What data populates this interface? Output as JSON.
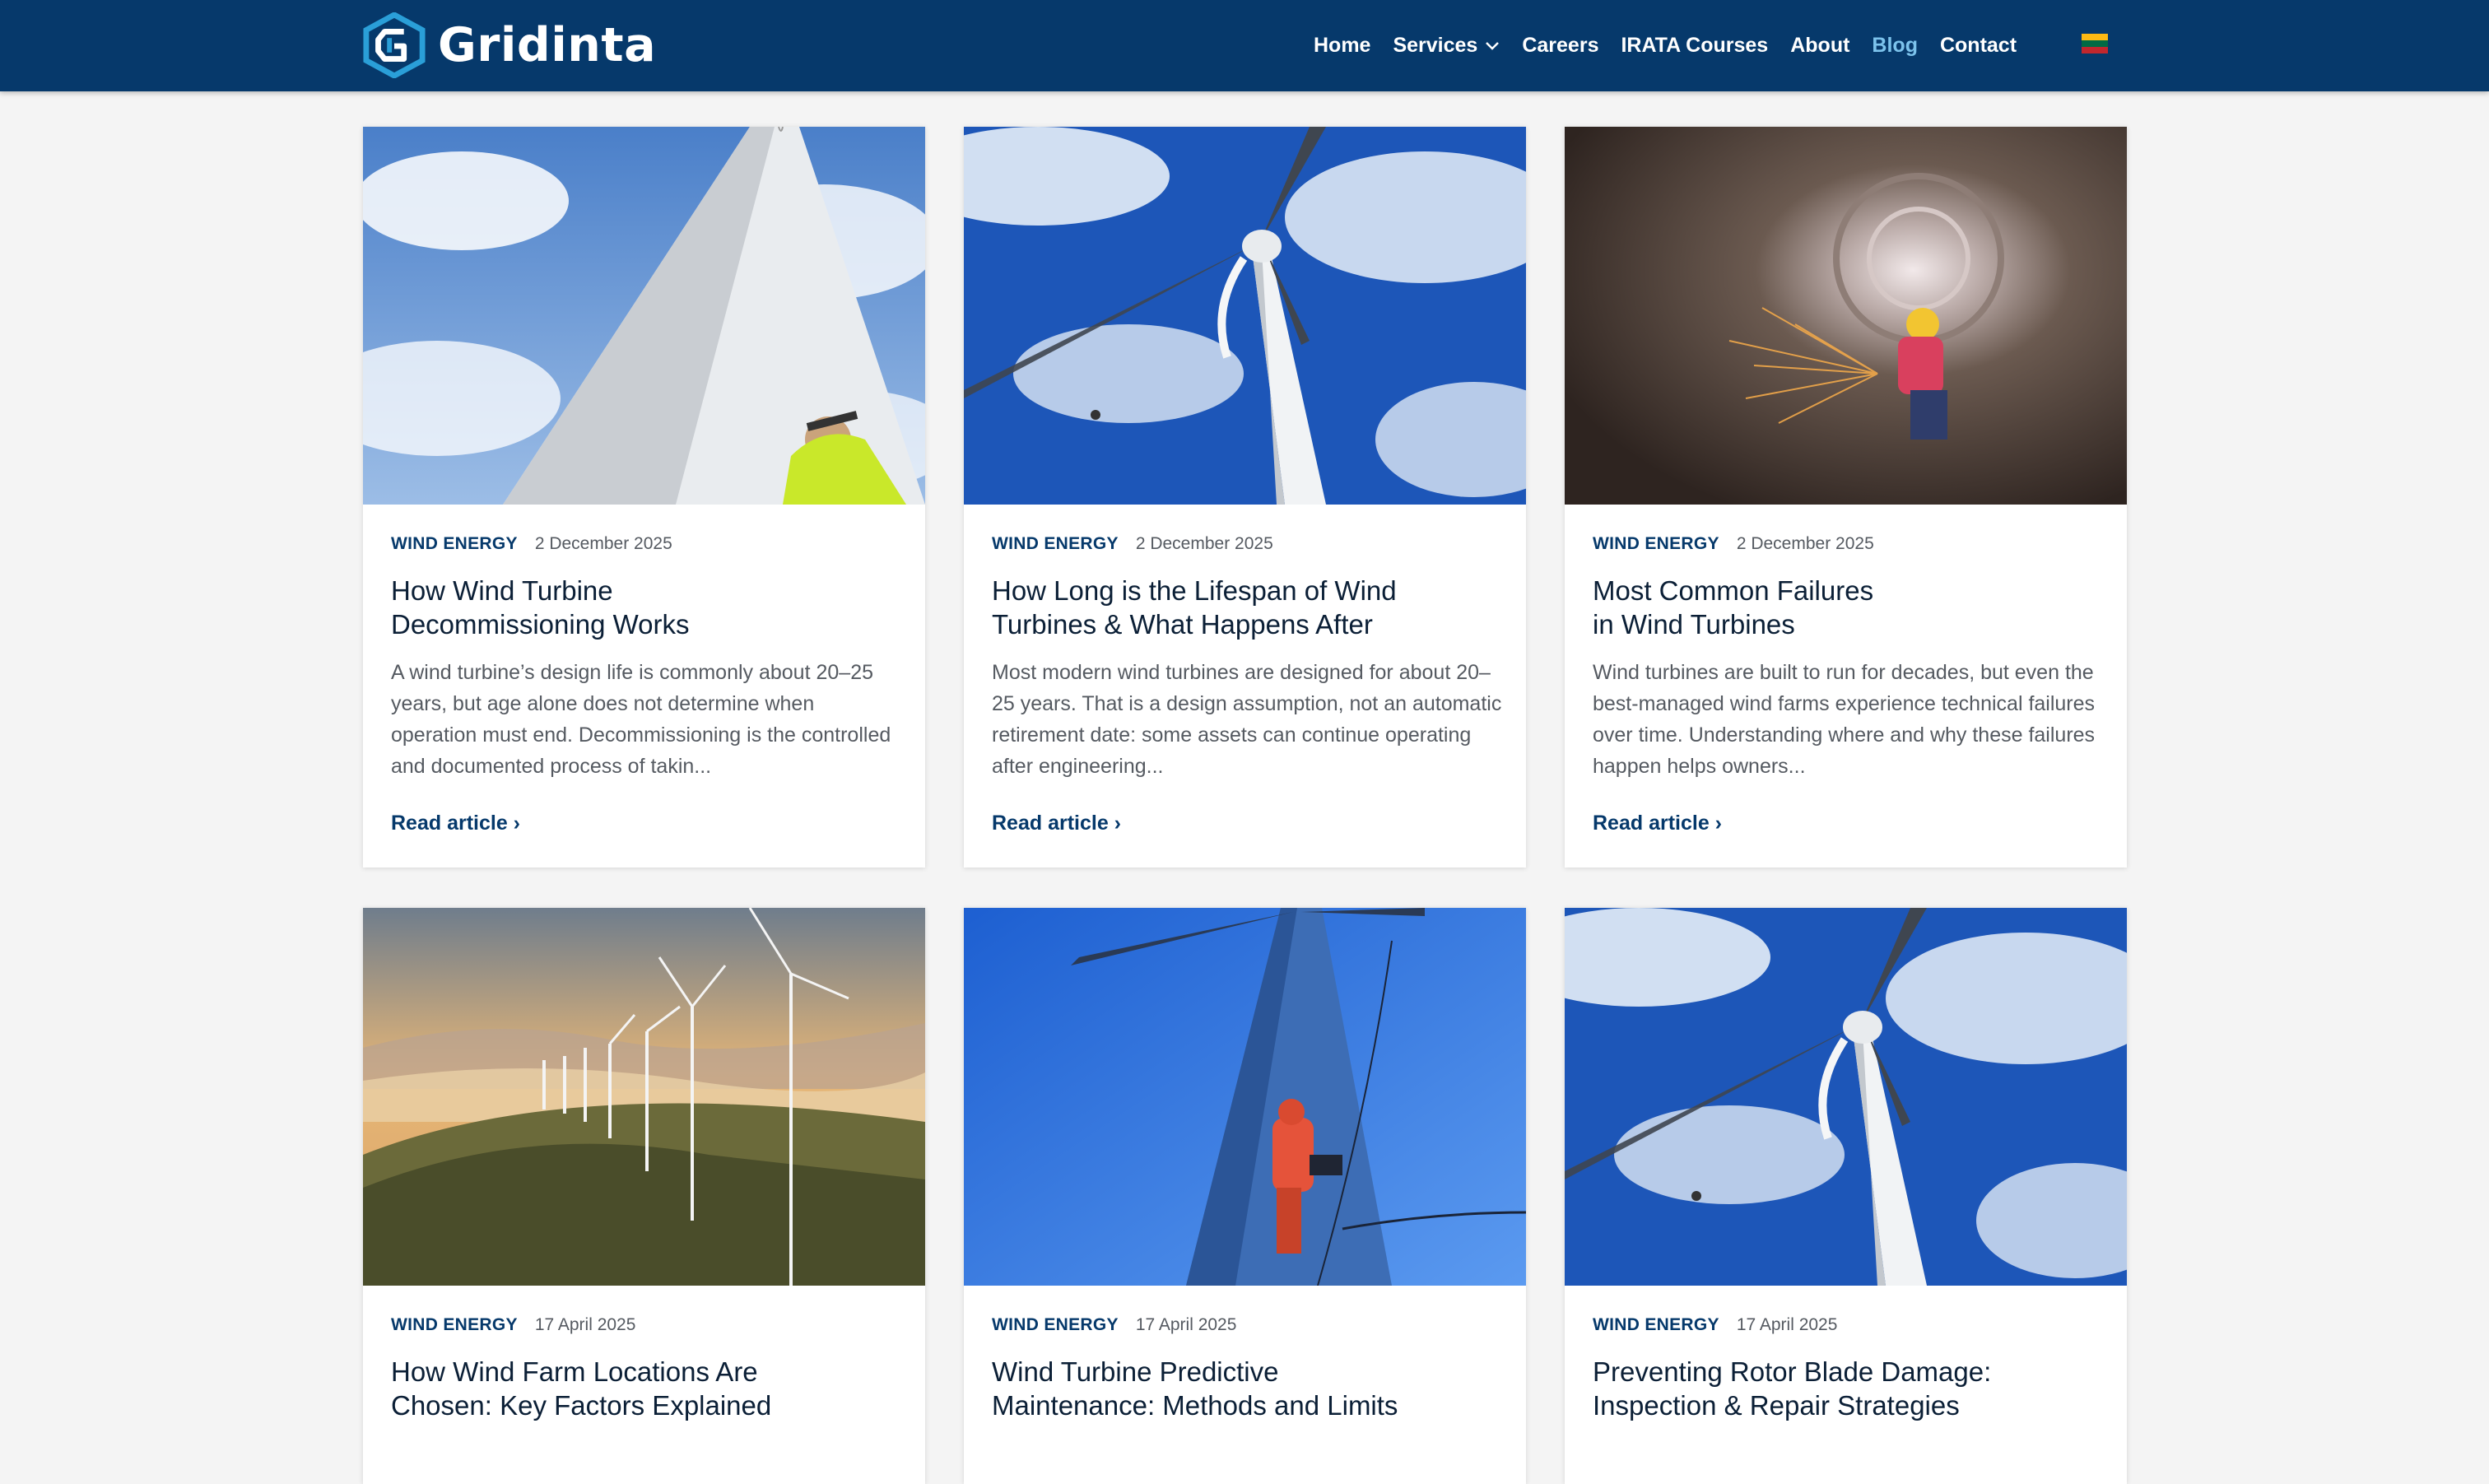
{
  "brand": {
    "name": "Gridinta"
  },
  "nav": {
    "items": [
      {
        "label": "Home"
      },
      {
        "label": "Services",
        "has_dropdown": true
      },
      {
        "label": "Careers"
      },
      {
        "label": "IRATA Courses"
      },
      {
        "label": "About"
      },
      {
        "label": "Blog",
        "active": true
      },
      {
        "label": "Contact"
      }
    ],
    "language_flag": "lithuania-flag-icon"
  },
  "colors": {
    "header_bg": "#06396b",
    "active_nav": "#7cc3ec",
    "category": "#06396b",
    "page_bg": "#f4f4f4"
  },
  "articles": [
    {
      "category": "WIND ENERGY",
      "date": "2 December 2025",
      "title_line1": "How Wind Turbine",
      "title_line2": "Decommissioning Works",
      "excerpt": "A wind turbine’s design life is commonly about 20–25 years, but age alone does not determine when operation must end. Decommissioning is the controlled and documented process of takin...",
      "link": "Read article ›",
      "image": "wind-turbine-tower-worker-photo"
    },
    {
      "category": "WIND ENERGY",
      "date": "2 December 2025",
      "title_line1": "How Long is the Lifespan of Wind",
      "title_line2": "Turbines & What Happens After",
      "excerpt": "Most modern wind turbines are designed for about 20–25 years. That is a design assumption, not an automatic retirement date: some assets can continue operating after engineering...",
      "link": "Read article ›",
      "image": "wind-turbine-sky-photo"
    },
    {
      "category": "WIND ENERGY",
      "date": "2 December 2025",
      "title_line1": "Most Common Failures",
      "title_line2": "in Wind Turbines",
      "excerpt": "Wind turbines are built to run for decades, but even the best-managed wind farms experience technical failures over time. Understanding where and why these failures happen helps owners...",
      "link": "Read article ›",
      "image": "tower-interior-grinding-photo"
    },
    {
      "category": "WIND ENERGY",
      "date": "17 April 2025",
      "title_line1": "How Wind Farm Locations Are",
      "title_line2": "Chosen: Key Factors Explained",
      "image": "wind-farm-hills-photo"
    },
    {
      "category": "WIND ENERGY",
      "date": "17 April 2025",
      "title_line1": "Wind Turbine Predictive",
      "title_line2": "Maintenance: Methods and Limits",
      "image": "rope-access-climber-photo"
    },
    {
      "category": "WIND ENERGY",
      "date": "17 April 2025",
      "title_line1": "Preventing Rotor Blade Damage:",
      "title_line2": "Inspection & Repair Strategies",
      "image": "wind-turbine-sky-photo-2"
    }
  ]
}
